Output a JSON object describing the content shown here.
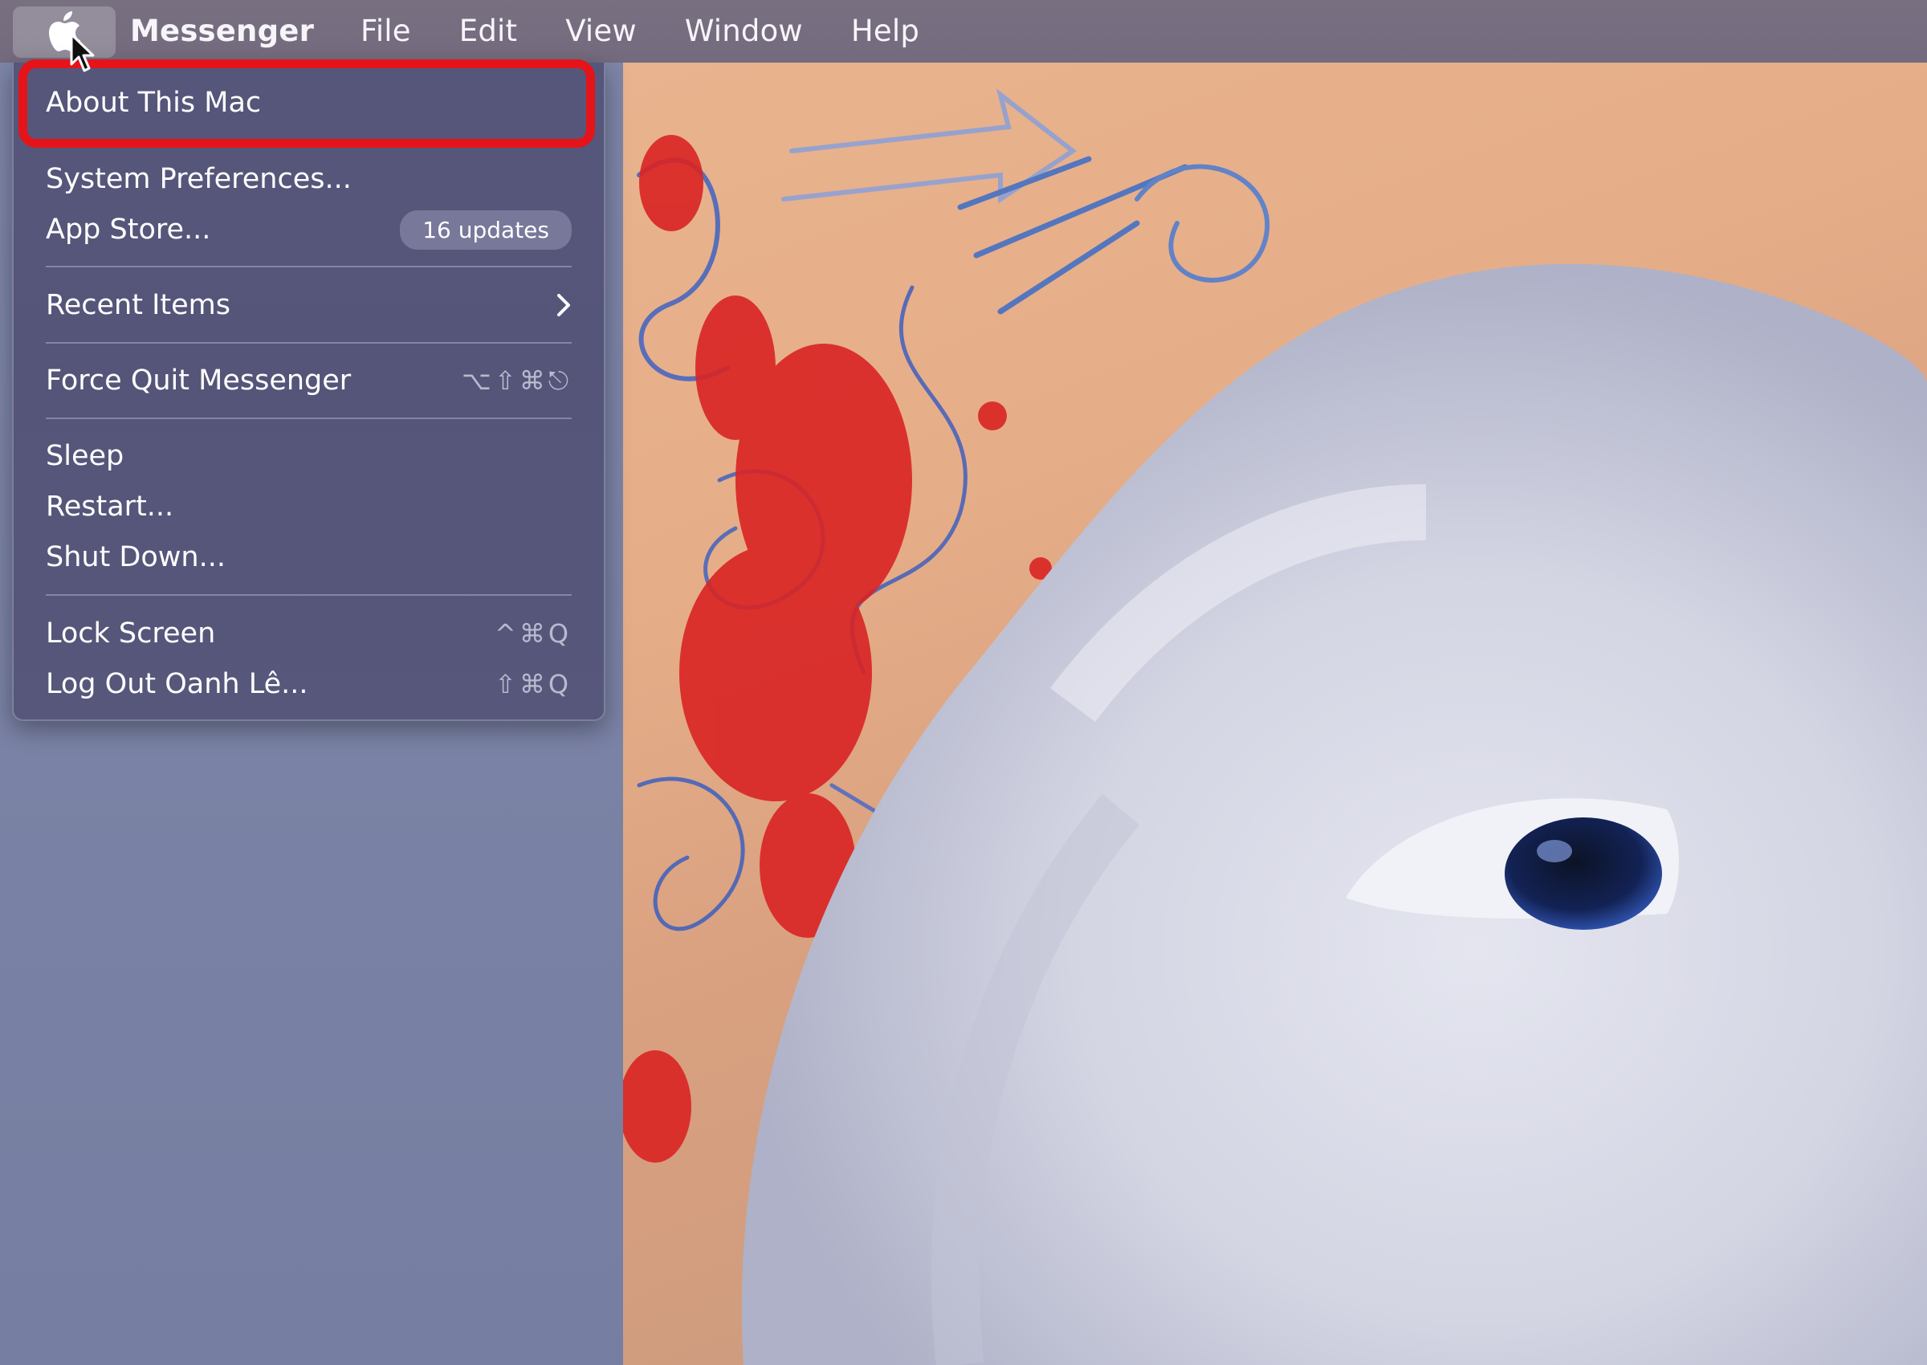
{
  "menubar": {
    "apple_icon": "apple-logo-icon",
    "items": [
      "Messenger",
      "File",
      "Edit",
      "View",
      "Window",
      "Help"
    ]
  },
  "apple_menu": {
    "about": "About This Mac",
    "system_prefs": "System Preferences...",
    "app_store": "App Store...",
    "app_store_badge": "16 updates",
    "recent_items": "Recent Items",
    "force_quit": "Force Quit Messenger",
    "force_quit_shortcut": "⌥⇧⌘⎋",
    "sleep": "Sleep",
    "restart": "Restart...",
    "shut_down": "Shut Down...",
    "lock_screen": "Lock Screen",
    "lock_screen_shortcut": "^⌘Q",
    "log_out": "Log Out Oanh Lê...",
    "log_out_shortcut": "⇧⌘Q"
  },
  "colors": {
    "highlight": "#e4141a",
    "menu_bg": "#56567b",
    "menubar_bg": "#786f81"
  }
}
